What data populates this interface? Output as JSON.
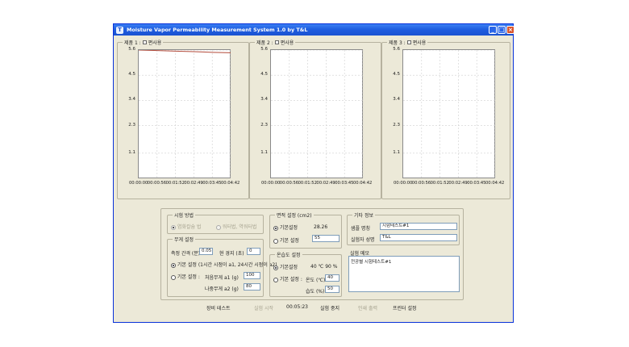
{
  "window": {
    "title": "Moisture Vapor Permeability Measurement System 1.0 by T&L",
    "app_icon": "T"
  },
  "titlebar_buttons": {
    "minimize": "_",
    "maximize": "□",
    "close": "×"
  },
  "charts": [
    {
      "group_label": "제품 1 :",
      "unused_label": "편사용",
      "unused_checked": false
    },
    {
      "group_label": "제품 2 :",
      "unused_label": "편사용",
      "unused_checked": false
    },
    {
      "group_label": "제품 3 :",
      "unused_label": "편사용",
      "unused_checked": false
    }
  ],
  "chart_data": [
    {
      "type": "line",
      "y_ticks": [
        "5.6",
        "4.5",
        "3.4",
        "2.3",
        "1.1"
      ],
      "x_ticks": [
        "00:00:00",
        "00:00:56",
        "00:01:52",
        "00:02:49",
        "00:03:45",
        "00:04:42"
      ],
      "ylim": [
        0,
        5.6
      ],
      "grid": true,
      "series": [
        {
          "x": [
            0,
            1,
            2,
            3,
            4,
            5
          ],
          "values": [
            5.6,
            5.58,
            5.55,
            5.53,
            5.5,
            5.48
          ],
          "color": "#b34a3a"
        }
      ]
    },
    {
      "type": "line",
      "y_ticks": [
        "5.6",
        "4.5",
        "3.4",
        "2.3",
        "1.1"
      ],
      "x_ticks": [
        "00:00:00",
        "00:00:56",
        "00:01:52",
        "00:02:49",
        "00:03:45",
        "00:04:42"
      ],
      "ylim": [
        0,
        5.6
      ],
      "grid": true,
      "series": []
    },
    {
      "type": "line",
      "y_ticks": [
        "5.6",
        "4.5",
        "3.4",
        "2.3",
        "1.1"
      ],
      "x_ticks": [
        "00:00:00",
        "00:00:56",
        "00:01:52",
        "00:02:49",
        "00:03:45",
        "00:04:42"
      ],
      "ylim": [
        0,
        5.6
      ],
      "grid": true,
      "series": []
    }
  ],
  "test_method": {
    "label": "시험 방법",
    "option1": "염화칼슘 법",
    "option2": "워터법, 역워터법"
  },
  "weight": {
    "label": "무게 설정",
    "interval_label": "측정 간격 (분)",
    "interval_value": "0.05",
    "elapsed_label": "현 경지 (초)",
    "elapsed_value": "0",
    "auto_label": "기본 설정 (1시간 시점이 a1, 24시간 시점이 a2)",
    "manual_label": "기본 설정 :",
    "initial_label": "처음무게 a1 (g)",
    "initial_value": "100",
    "final_label": "나중무게 a2 (g)",
    "final_value": "80"
  },
  "area": {
    "label": "면적 설정 (cm2)",
    "default_label": "기본설정",
    "default_value": "28.26",
    "custom_label": "기본 설정",
    "custom_value": "55"
  },
  "temp_hum": {
    "label": "온습도 설정",
    "default_label": "기본설정",
    "default_value": "40 ℃  90 %",
    "custom_label": "기본 설정 :",
    "temp_label": "온도 (℃)",
    "temp_value": "40",
    "hum_label": "습도 (%)",
    "hum_value": "50"
  },
  "other": {
    "label": "기타 정보",
    "sample_label": "샘플 명칭",
    "sample_value": "시험테스트#1",
    "tester_label": "실험자 성명",
    "tester_value": "T&L"
  },
  "memo": {
    "label": "실험 메모",
    "value": "전공별 시험테스트#1"
  },
  "bottom": {
    "device_test": "장비 테스트",
    "start": "실험 시작",
    "timer": "00:05:23",
    "stop": "실험 중지",
    "save": "인쇄 출력",
    "print_setup": "프린터 설정"
  }
}
